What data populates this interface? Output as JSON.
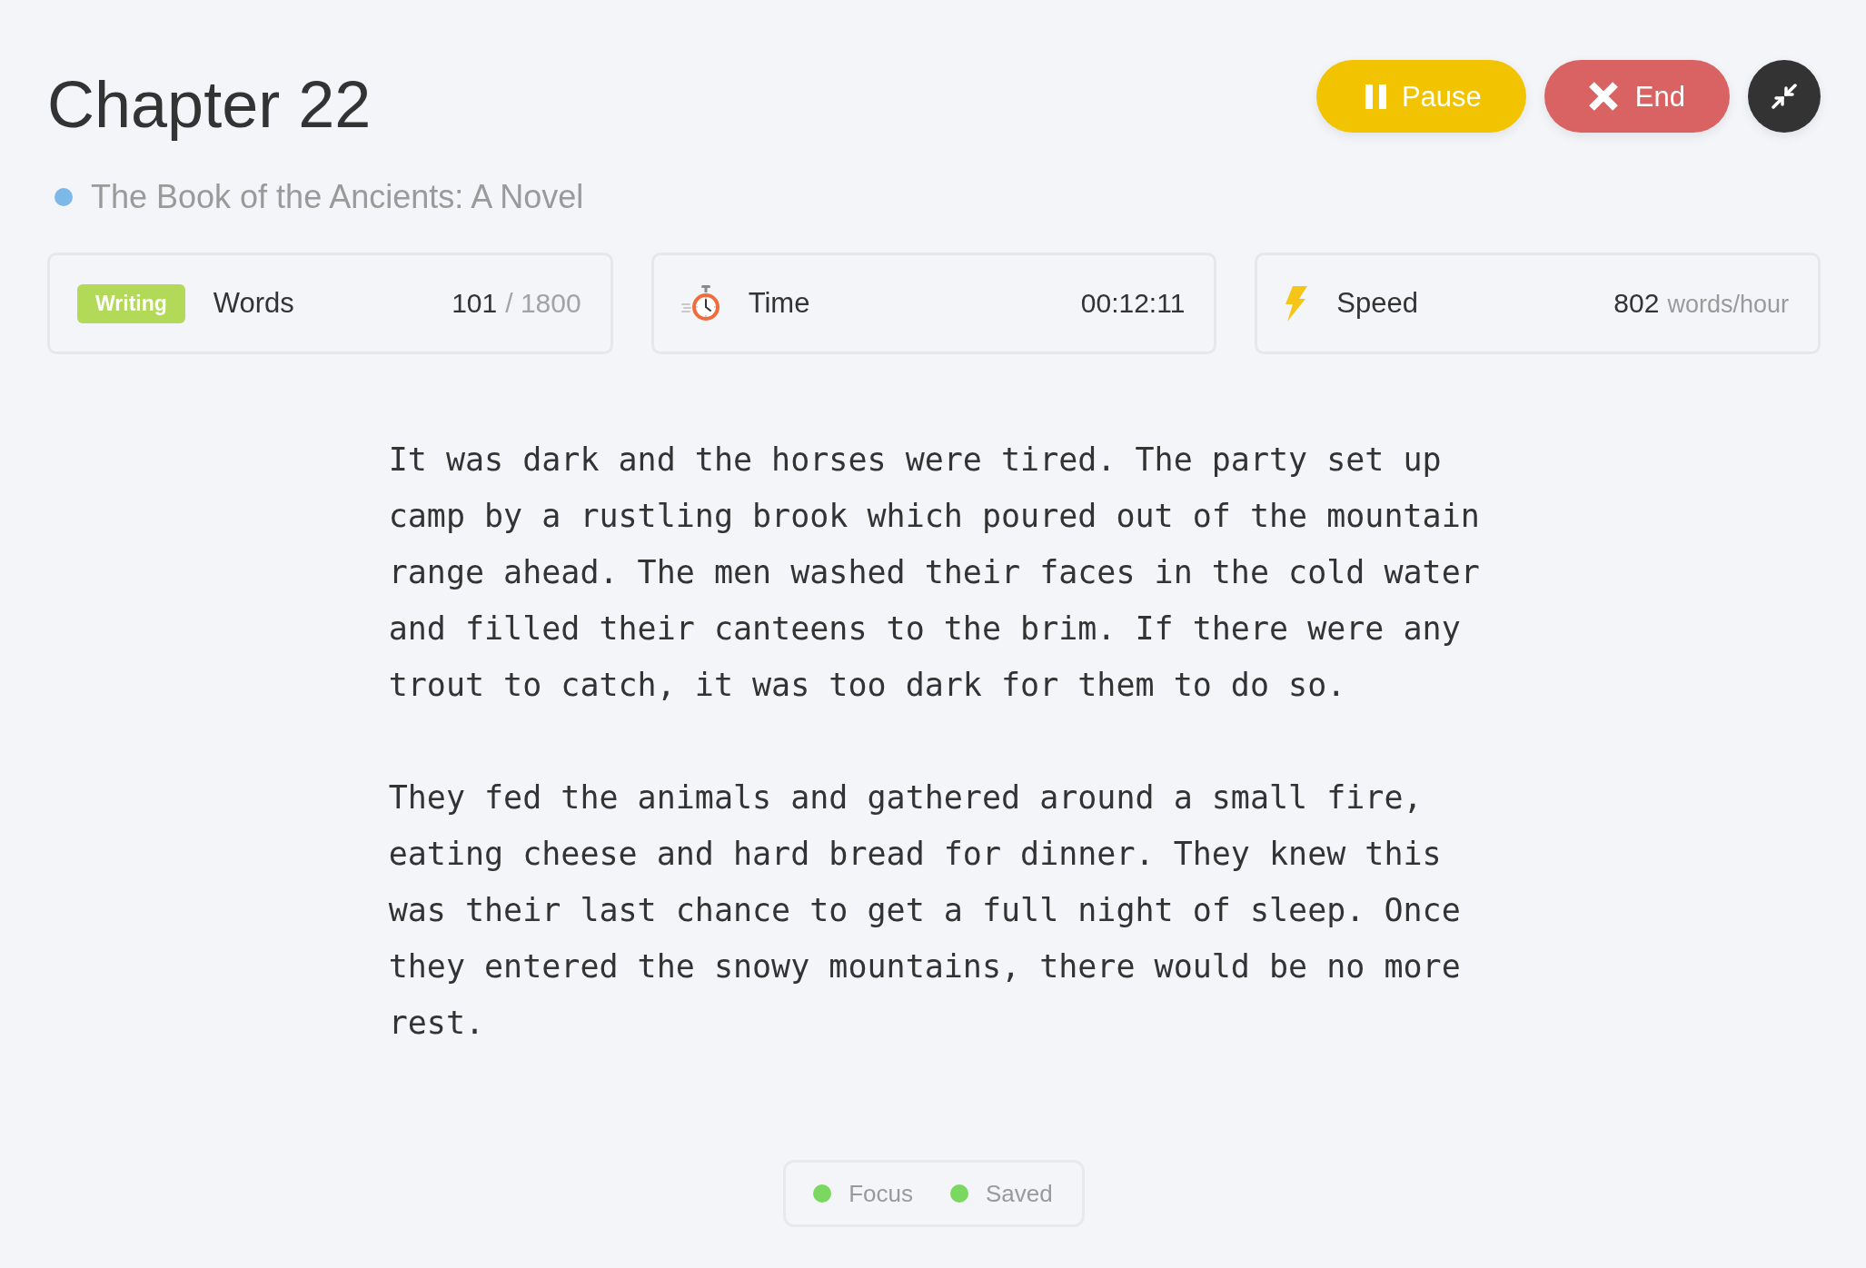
{
  "header": {
    "title": "Chapter 22",
    "project": "The Book of the Ancients: A Novel",
    "actions": [
      {
        "kind": "pause",
        "label": "Pause"
      },
      {
        "kind": "end",
        "label": "End"
      },
      {
        "kind": "collapse"
      }
    ]
  },
  "stats": [
    {
      "kind": "words",
      "badge": "Writing",
      "label": "Words",
      "value": "101",
      "goal": "/ 1800"
    },
    {
      "kind": "time",
      "label": "Time",
      "value": "00:12:11"
    },
    {
      "kind": "speed",
      "label": "Speed",
      "value": "802",
      "unit": "words/hour"
    }
  ],
  "manuscript": {
    "paragraphs": [
      "It was dark and the horses were tired. The party set up camp by a rustling brook which poured out of the mountain range ahead. The men washed their faces in the cold water and filled their canteens to the brim. If there were any trout to catch, it was too dark for them to do so.",
      "They fed the animals and gathered around a small fire, eating cheese and hard bread for dinner. They knew this was their last chance to get a full night of sleep. Once they entered the snowy mountains, there would be no more rest."
    ]
  },
  "status_bar": {
    "items": [
      {
        "label": "Focus",
        "on": true
      },
      {
        "label": "Saved",
        "on": true
      }
    ]
  }
}
